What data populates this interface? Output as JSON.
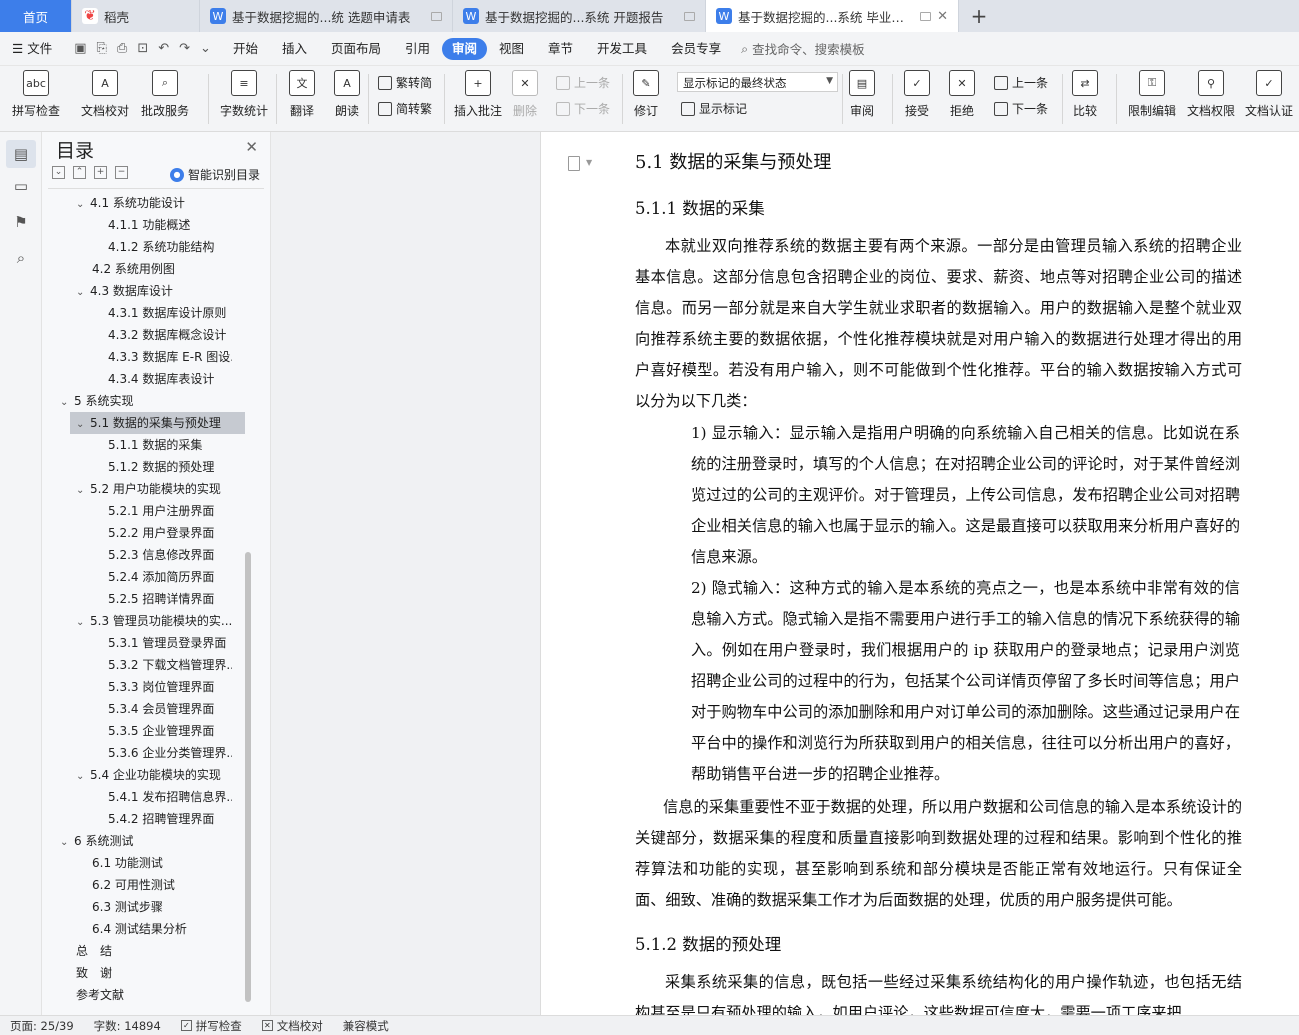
{
  "tabs": [
    {
      "label": "首页"
    },
    {
      "label": "稻壳"
    },
    {
      "label": "基于数据挖掘的...统 选题申请表"
    },
    {
      "label": "基于数据挖掘的...系统 开题报告"
    },
    {
      "label": "基于数据挖掘的...系统 毕业论文"
    }
  ],
  "menu": {
    "file": "文件",
    "items": [
      "开始",
      "插入",
      "页面布局",
      "引用",
      "审阅",
      "视图",
      "章节",
      "开发工具",
      "会员专享"
    ],
    "active": "审阅",
    "search": "查找命令、搜索模板"
  },
  "ribbon": {
    "spell": "拼写检查",
    "doc_check": "文档校对",
    "batch": "批改服务",
    "word_count": "字数统计",
    "translate": "翻译",
    "read_aloud": "朗读",
    "trad": "繁转简",
    "simp": "简转繁",
    "insert_comment": "插入批注",
    "delete": "删除",
    "prev_comment": "上一条",
    "next_comment": "下一条",
    "revise": "修订",
    "markup_select": "显示标记的最终状态",
    "show_markup": "显示标记",
    "review": "审阅",
    "accept": "接受",
    "reject": "拒绝",
    "prev_change": "上一条",
    "next_change": "下一条",
    "compare": "比较",
    "restrict": "限制编辑",
    "permission": "文档权限",
    "certify": "文档认证"
  },
  "toc": {
    "title": "目录",
    "smart": "智能识别目录",
    "items": [
      {
        "label": "4.1 系统功能设计",
        "level": 2,
        "chev": "down"
      },
      {
        "label": "4.1.1 功能概述",
        "level": 3
      },
      {
        "label": "4.1.2 系统功能结构",
        "level": 3
      },
      {
        "label": "4.2 系统用例图",
        "level": 2
      },
      {
        "label": "4.3 数据库设计",
        "level": 2,
        "chev": "down"
      },
      {
        "label": "4.3.1 数据库设计原则",
        "level": 3
      },
      {
        "label": "4.3.2 数据库概念设计",
        "level": 3
      },
      {
        "label": "4.3.3 数据库 E-R 图设...",
        "level": 3
      },
      {
        "label": "4.3.4 数据库表设计",
        "level": 3
      },
      {
        "label": "5  系统实现",
        "level": 1,
        "chev": "down"
      },
      {
        "label": "5.1 数据的采集与预处理",
        "level": 2,
        "chev": "down",
        "active": true
      },
      {
        "label": "5.1.1 数据的采集",
        "level": 3
      },
      {
        "label": "5.1.2 数据的预处理",
        "level": 3
      },
      {
        "label": "5.2 用户功能模块的实现",
        "level": 2,
        "chev": "down"
      },
      {
        "label": "5.2.1  用户注册界面",
        "level": 3
      },
      {
        "label": "5.2.2 用户登录界面",
        "level": 3
      },
      {
        "label": "5.2.3 信息修改界面",
        "level": 3
      },
      {
        "label": "5.2.4 添加简历界面",
        "level": 3
      },
      {
        "label": "5.2.5 招聘详情界面",
        "level": 3
      },
      {
        "label": "5.3 管理员功能模块的实...",
        "level": 2,
        "chev": "down"
      },
      {
        "label": "5.3.1 管理员登录界面",
        "level": 3
      },
      {
        "label": "5.3.2 下载文档管理界...",
        "level": 3
      },
      {
        "label": "5.3.3 岗位管理界面",
        "level": 3
      },
      {
        "label": "5.3.4 会员管理界面",
        "level": 3
      },
      {
        "label": "5.3.5 企业管理界面",
        "level": 3
      },
      {
        "label": "5.3.6 企业分类管理界...",
        "level": 3
      },
      {
        "label": "5.4 企业功能模块的实现",
        "level": 2,
        "chev": "down"
      },
      {
        "label": "5.4.1 发布招聘信息界...",
        "level": 3
      },
      {
        "label": "5.4.2 招聘管理界面",
        "level": 3
      },
      {
        "label": "6  系统测试",
        "level": 1,
        "chev": "down"
      },
      {
        "label": "6.1 功能测试",
        "level": 2
      },
      {
        "label": "6.2 可用性测试",
        "level": 2
      },
      {
        "label": "6.3 测试步骤",
        "level": 2
      },
      {
        "label": "6.4 测试结果分析",
        "level": 2
      },
      {
        "label": "总　结",
        "level": 1
      },
      {
        "label": "致　谢",
        "level": 1
      },
      {
        "label": "参考文献",
        "level": 1
      }
    ]
  },
  "doc": {
    "h1": "5.1 数据的采集与预处理",
    "h2a": "5.1.1 数据的采集",
    "p1": "本就业双向推荐系统的数据主要有两个来源。一部分是由管理员输入系统的招聘企业基本信息。这部分信息包含招聘企业的岗位、要求、薪资、地点等对招聘企业公司的描述信息。而另一部分就是来自大学生就业求职者的数据输入。用户的数据输入是整个就业双向推荐系统主要的数据依据，个性化推荐模块就是对用户输入的数据进行处理才得出的用户喜好模型。若没有用户输入，则不可能做到个性化推荐。平台的输入数据按输入方式可以分为以下几类：",
    "p2": "1) 显示输入：显示输入是指用户明确的向系统输入自己相关的信息。比如说在系统的注册登录时，填写的个人信息；在对招聘企业公司的评论时，对于某件曾经浏览过过的公司的主观评价。对于管理员，上传公司信息，发布招聘企业公司对招聘企业相关信息的输入也属于显示的输入。这是最直接可以获取用来分析用户喜好的信息来源。",
    "p3": "2) 隐式输入：这种方式的输入是本系统的亮点之一，也是本系统中非常有效的信息输入方式。隐式输入是指不需要用户进行手工的输入信息的情况下系统获得的输入。例如在用户登录时，我们根据用户的 ip 获取用户的登录地点；记录用户浏览招聘企业公司的过程中的行为，包括某个公司详情页停留了多长时间等信息；用户对于购物车中公司的添加删除和用户对订单公司的添加删除。这些通过记录用户在平台中的操作和浏览行为所获取到用户的相关信息，往往可以分析出用户的喜好，帮助销售平台进一步的招聘企业推荐。",
    "p4": "信息的采集重要性不亚于数据的处理，所以用户数据和公司信息的输入是本系统设计的关键部分，数据采集的程度和质量直接影响到数据处理的过程和结果。影响到个性化的推荐算法和功能的实现，甚至影响到系统和部分模块是否能正常有效地运行。只有保证全面、细致、准确的数据采集工作才为后面数据的处理，优质的用户服务提供可能。",
    "h2b": "5.1.2 数据的预处理",
    "p5": "采集系统采集的信息，既包括一些经过采集系统结构化的用户操作轨迹，也包括无结构甚至是只有预处理的输入，如用户评论，这些数据可信度大，需要一项工序来把"
  },
  "status": {
    "page": "页面: 25/39",
    "words": "字数: 14894",
    "spell": "拼写检查",
    "doc_check": "文档校对",
    "compat": "兼容模式"
  },
  "colors": {
    "accent": "#3d7eea",
    "toc_active": "#c6cad1"
  }
}
